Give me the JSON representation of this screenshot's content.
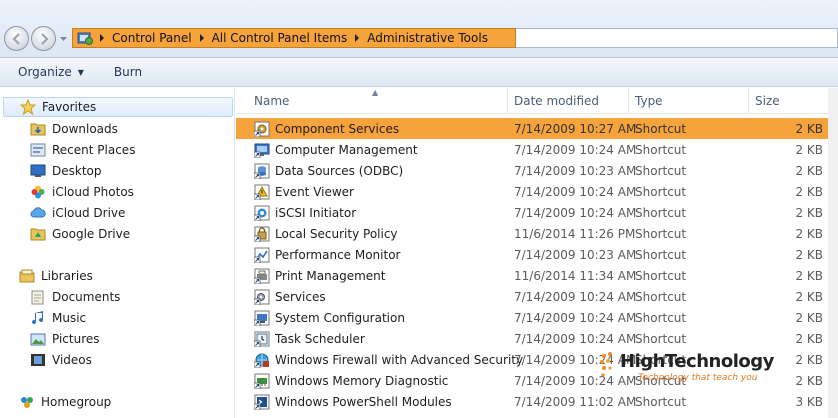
{
  "address": {
    "crumbs": [
      "Control Panel",
      "All Control Panel Items",
      "Administrative Tools"
    ]
  },
  "toolbar": {
    "organize_label": "Organize",
    "burn_label": "Burn"
  },
  "nav": {
    "favorites_label": "Favorites",
    "favorites": [
      "Downloads",
      "Recent Places",
      "Desktop",
      "iCloud Photos",
      "iCloud Drive",
      "Google Drive"
    ],
    "libraries_label": "Libraries",
    "libraries": [
      "Documents",
      "Music",
      "Pictures",
      "Videos"
    ],
    "homegroup_label": "Homegroup"
  },
  "columns": {
    "name": "Name",
    "date": "Date modified",
    "type": "Type",
    "size": "Size"
  },
  "files": [
    {
      "name": "Component Services",
      "date": "7/14/2009 10:27 AM",
      "type": "Shortcut",
      "size": "2 KB",
      "icon": "component-services-icon",
      "selected": true
    },
    {
      "name": "Computer Management",
      "date": "7/14/2009 10:24 AM",
      "type": "Shortcut",
      "size": "2 KB",
      "icon": "computer-management-icon"
    },
    {
      "name": "Data Sources (ODBC)",
      "date": "7/14/2009 10:23 AM",
      "type": "Shortcut",
      "size": "2 KB",
      "icon": "odbc-icon"
    },
    {
      "name": "Event Viewer",
      "date": "7/14/2009 10:24 AM",
      "type": "Shortcut",
      "size": "2 KB",
      "icon": "event-viewer-icon"
    },
    {
      "name": "iSCSI Initiator",
      "date": "7/14/2009 10:24 AM",
      "type": "Shortcut",
      "size": "2 KB",
      "icon": "iscsi-icon"
    },
    {
      "name": "Local Security Policy",
      "date": "11/6/2014 11:26 PM",
      "type": "Shortcut",
      "size": "2 KB",
      "icon": "security-policy-icon"
    },
    {
      "name": "Performance Monitor",
      "date": "7/14/2009 10:23 AM",
      "type": "Shortcut",
      "size": "2 KB",
      "icon": "performance-monitor-icon"
    },
    {
      "name": "Print Management",
      "date": "11/6/2014 11:34 AM",
      "type": "Shortcut",
      "size": "2 KB",
      "icon": "print-management-icon"
    },
    {
      "name": "Services",
      "date": "7/14/2009 10:24 AM",
      "type": "Shortcut",
      "size": "2 KB",
      "icon": "services-icon"
    },
    {
      "name": "System Configuration",
      "date": "7/14/2009 10:24 AM",
      "type": "Shortcut",
      "size": "2 KB",
      "icon": "system-configuration-icon"
    },
    {
      "name": "Task Scheduler",
      "date": "7/14/2009 10:24 AM",
      "type": "Shortcut",
      "size": "2 KB",
      "icon": "task-scheduler-icon"
    },
    {
      "name": "Windows Firewall with Advanced Security",
      "date": "7/14/2009 10:24 AM",
      "type": "Shortcut",
      "size": "2 KB",
      "icon": "firewall-icon"
    },
    {
      "name": "Windows Memory Diagnostic",
      "date": "7/14/2009 10:24 AM",
      "type": "Shortcut",
      "size": "2 KB",
      "icon": "memory-diagnostic-icon"
    },
    {
      "name": "Windows PowerShell Modules",
      "date": "7/14/2009 11:02 AM",
      "type": "Shortcut",
      "size": "3 KB",
      "icon": "powershell-icon"
    }
  ],
  "watermark": {
    "title": "HighTechnology",
    "tagline": "Technology that teach you"
  },
  "colors": {
    "selection": "#f6a33b",
    "toolbar_text": "#1e395b"
  }
}
